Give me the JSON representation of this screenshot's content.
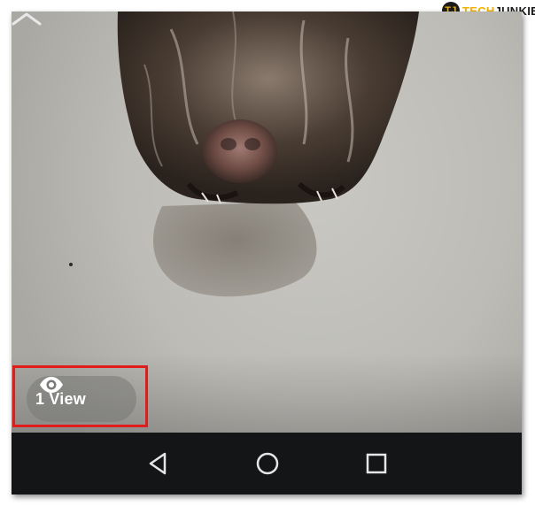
{
  "watermark": {
    "logo_letters": "TJ",
    "brand_part1": "TECH",
    "brand_part2": "JUNKIE"
  },
  "story_viewer": {
    "view_count_label": "1 View",
    "view_icon": "eye-icon",
    "swipe_up_icon": "chevron-up-icon"
  },
  "highlight": {
    "color": "#e21b1b"
  },
  "navigation_bar": {
    "buttons": [
      {
        "name": "back",
        "icon": "back-triangle-icon"
      },
      {
        "name": "home",
        "icon": "home-circle-icon"
      },
      {
        "name": "recents",
        "icon": "recents-square-icon"
      }
    ],
    "background": "#141517"
  }
}
